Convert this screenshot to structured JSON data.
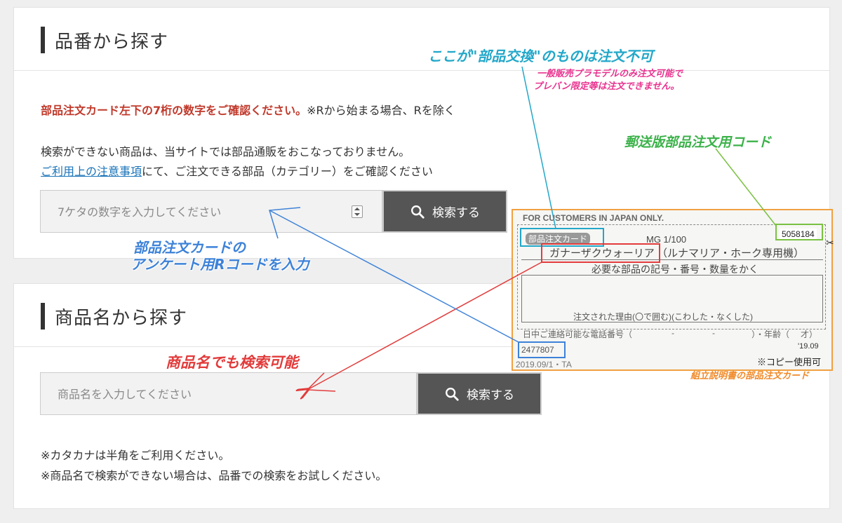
{
  "section1": {
    "title": "品番から探す",
    "notice_red": "部品注文カード左下の7桁の数字をご確認ください。",
    "notice_suffix": "※Rから始まる場合、Rを除く",
    "line1": "検索ができない商品は、当サイトでは部品通販をおこなっておりません。",
    "link_text": "ご利用上の注意事項",
    "line2_rest": "にて、ご注文できる部品（カテゴリー）をご確認ください",
    "input_placeholder": "7ケタの数字を入力してください",
    "search_label": "検索する"
  },
  "section2": {
    "title": "商品名から探す",
    "input_placeholder": "商品名を入力してください",
    "search_label": "検索する",
    "note1": "※カタカナは半角をご利用ください。",
    "note2": "※商品名で検索ができない場合は、品番での検索をお試しください。"
  },
  "annotations": {
    "blue_line1": "部品注文カードの",
    "blue_line2": "アンケート用Rコードを入力",
    "red": "商品名でも検索可能",
    "cyan": "ここが\"部品交換\"のものは注文不可",
    "pink_line1": "一般販売プラモデルのみ注文可能で",
    "pink_line2": "プレバン限定等は注文できません。",
    "green": "郵送版部品注文用コード",
    "orange": "組立説明書の部品注文カード"
  },
  "card": {
    "header": "FOR CUSTOMERS IN JAPAN ONLY.",
    "label": "部品注文カード",
    "code": "5058184",
    "grade": "MG 1/100",
    "product_left": "ガナーザクウォーリア",
    "product_right": "（ルナマリア・ホーク専用機）",
    "instruction": "必要な部品の記号・番号・数量をかく",
    "reason": "注文された理由(〇で囲む)(こわした・なくした)",
    "phone_label": "日中ご連絡可能な電話番号（",
    "phone_sep1": "-",
    "phone_sep2": "-",
    "age": "）・年齢（",
    "age_unit": "才）",
    "r_code": "2477807",
    "date_code": "'19.09",
    "print_code": "2019.09/1・TA",
    "copy_ok": "※コピー使用可"
  },
  "colors": {
    "blue": "#3d82d8",
    "red": "#e23b3b",
    "cyan": "#22a7c9",
    "pink": "#e8338f",
    "green": "#3cb24a",
    "orange": "#f08a2a",
    "button": "#555555",
    "notice_red": "#c0392b",
    "link": "#1a73b8"
  }
}
